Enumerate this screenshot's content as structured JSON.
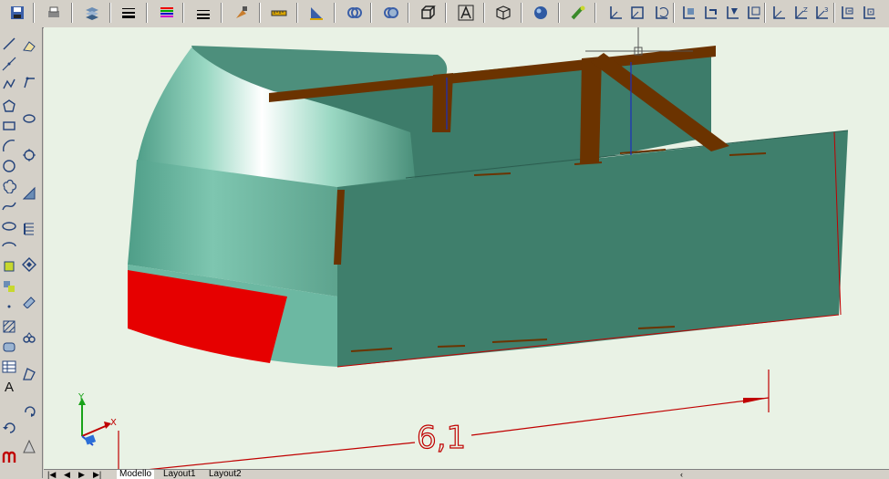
{
  "toolbar": {
    "icons": [
      "save-icon",
      "print-icon",
      "layers-icon",
      "lineweight-icon",
      "color-icon",
      "linetype-icon",
      "match-icon",
      "measure-icon",
      "dimension-icon",
      "union-icon",
      "subtract-icon",
      "extrude-icon",
      "text-style-icon",
      "box-icon",
      "sphere-icon",
      "render-icon",
      "ucs-icon",
      "ucs-world-icon",
      "ucs-previous-icon",
      "ucs-face-icon",
      "ucs-object-icon",
      "ucs-view-icon",
      "ucs-origin-icon",
      "ucs-x-icon",
      "ucs-z-icon",
      "ucs-3point-icon",
      "ucs-rotate-icon",
      "ucs-apply-icon"
    ]
  },
  "left_toolbar": {
    "text_tool_label": "A"
  },
  "drawing": {
    "dimension_text": "6,1",
    "axis_labels": {
      "x": "X",
      "y": "Y"
    },
    "colors": {
      "hull": "#3f7f6c",
      "hull_light": "#8fd1bd",
      "red_panel": "#e60000",
      "beam": "#6b3300",
      "dimension": "#c00000",
      "background": "#e9f2e5"
    }
  },
  "tabs": {
    "items": [
      "Modello",
      "Layout1",
      "Layout2"
    ]
  }
}
